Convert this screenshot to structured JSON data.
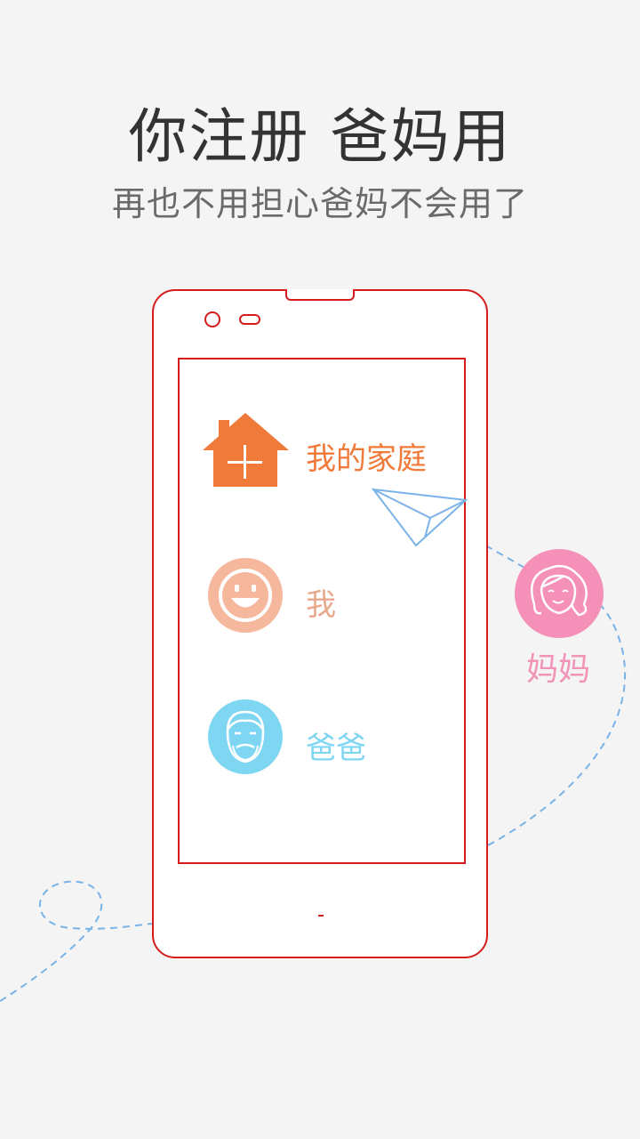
{
  "header": {
    "title": "你注册 爸妈用",
    "subtitle": "再也不用担心爸妈不会用了"
  },
  "phone_menu": {
    "items": [
      {
        "label": "我的家庭",
        "icon": "house-plus-icon",
        "color": "#f07a3a"
      },
      {
        "label": "我",
        "icon": "smiley-face-icon",
        "color": "#e9a88c"
      },
      {
        "label": "爸爸",
        "icon": "father-face-icon",
        "color": "#7fd6f2"
      }
    ]
  },
  "mom": {
    "label": "妈妈",
    "icon": "mother-face-icon",
    "color": "#f293b8"
  },
  "colors": {
    "phone_outline": "#d41c1c",
    "dashed_path": "#7ab3e8",
    "background": "#f4f4f4"
  }
}
